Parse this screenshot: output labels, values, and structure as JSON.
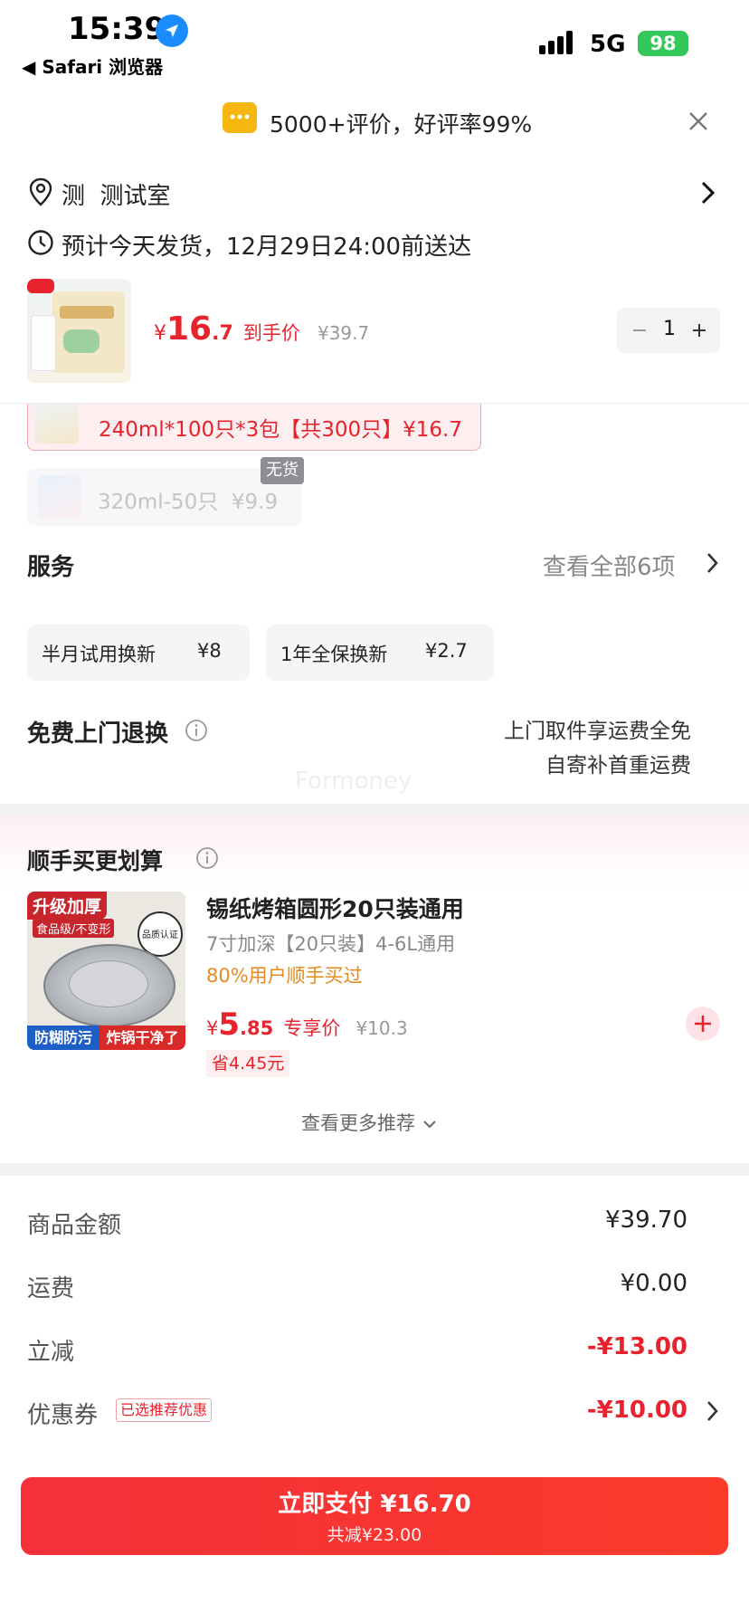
{
  "status_bar": {
    "time": "15:39",
    "back_app": "◀ Safari 浏览器",
    "network": "5G",
    "battery": "98"
  },
  "colors": {
    "accent_red": "#e8232d",
    "pay_button": "#f5303a",
    "bg_gray": "#f5f5f7",
    "orange": "#e58a1f"
  },
  "banner": {
    "text": "5000+评价，好评率99%"
  },
  "address": {
    "text": "测  测试室"
  },
  "delivery": {
    "text": "预计今天发货，12月29日24:00前送达"
  },
  "product": {
    "price_symbol": "¥",
    "price_int": "16",
    "price_dec": ".7",
    "price_label": "到手价",
    "orig_price": "¥39.7",
    "quantity": "1"
  },
  "variants": [
    {
      "label": "240ml*100只*3包【共300只】¥16.7",
      "selected": true
    },
    {
      "label": "320ml-50只  ¥9.9",
      "badge": "无货",
      "out_of_stock": true
    }
  ],
  "service": {
    "title": "服务",
    "view_all": "查看全部6项",
    "options": [
      {
        "name": "半月试用换新",
        "price": "¥8"
      },
      {
        "name": "1年全保换新",
        "price": "¥2.7"
      }
    ]
  },
  "returns": {
    "title": "免费上门退换",
    "line1": "上门取件享运费全免",
    "line2": "自寄补首重运费"
  },
  "watermark": "Formoney",
  "addon": {
    "section_title": "顺手买更划算",
    "img_top": "升级加厚",
    "img_sub": "食品级/不变形",
    "img_badge": "品质认证",
    "img_bottom_left": "防糊防污",
    "img_bottom_right": "炸锅干净了",
    "title": "锡纸烤箱圆形20只装通用",
    "spec": "7寸加深【20只装】4-6L通用",
    "social": "80%用户顺手买过",
    "price_symbol": "¥",
    "price_int": "5",
    "price_dec": ".85",
    "price_label": "专享价",
    "orig_price": "¥10.3",
    "save": "省4.45元",
    "more": "查看更多推荐"
  },
  "summary": [
    {
      "label": "商品金额",
      "value": "¥39.70"
    },
    {
      "label": "运费",
      "value": "¥0.00"
    },
    {
      "label": "立减",
      "value": "-¥13.00"
    },
    {
      "label": "优惠券",
      "tag": "已选推荐优惠",
      "value": "-¥10.00"
    }
  ],
  "pay": {
    "label": "立即支付 ¥16.70",
    "sub": "共减¥23.00"
  }
}
